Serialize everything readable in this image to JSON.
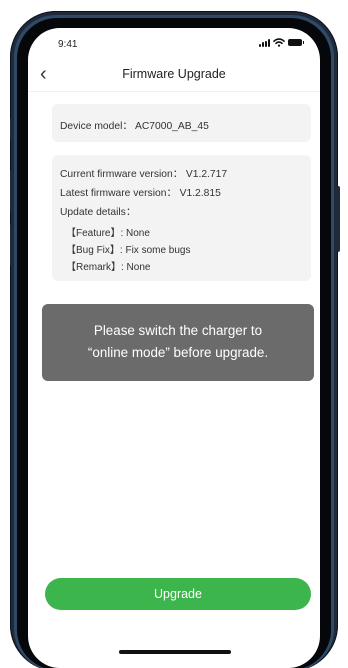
{
  "status_bar": {
    "time": "9:41"
  },
  "header": {
    "title": "Firmware Upgrade",
    "back_icon": "chevron-left-icon"
  },
  "device": {
    "model_text": "Device model： AC7000_AB_45"
  },
  "firmware": {
    "current": "Current firmware version： V1.2.717",
    "latest": "Latest firmware version： V1.2.815",
    "details_label": "Update details：",
    "notes": [
      "【Feature】: None",
      "【Bug Fix】: Fix some bugs",
      "【Remark】: None"
    ]
  },
  "toast": {
    "line1": "Please switch the charger to",
    "line2": "“online mode” before upgrade."
  },
  "actions": {
    "upgrade_label": "Upgrade"
  },
  "colors": {
    "accent": "#3cb64c",
    "toast_bg": "#6b6b6b",
    "card_bg": "#f3f3f3",
    "frame": "#2f4a66"
  }
}
